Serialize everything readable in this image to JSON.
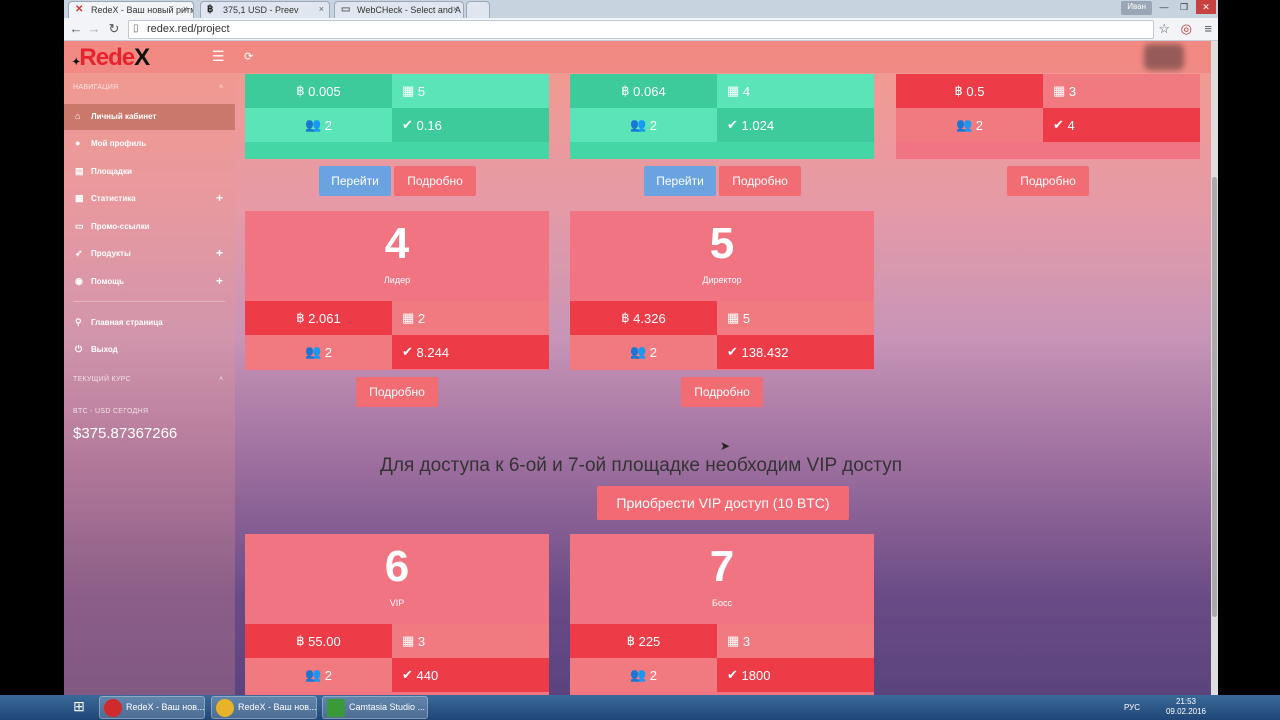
{
  "tabs": [
    {
      "label": "RedeX - Ваш новый ритм",
      "icon": "x-icon"
    },
    {
      "label": "375,1 USD - Preev",
      "icon": "bitcoin-icon"
    },
    {
      "label": "WebCHeck - Select and A",
      "icon": "page-icon"
    }
  ],
  "window": {
    "user": "Иван",
    "minimize": "—",
    "maximize": "❐",
    "close": "✕"
  },
  "address": {
    "url": "redex.red/project"
  },
  "logo": {
    "text": "Rede",
    "x": "X"
  },
  "sidebar": {
    "nav_heading": "НАВИГАЦИЯ",
    "items": [
      {
        "label": "Личный кабинет",
        "icon": "home-icon"
      },
      {
        "label": "Мой профиль",
        "icon": "user-icon"
      },
      {
        "label": "Площадки",
        "icon": "grid-icon"
      },
      {
        "label": "Статистика",
        "icon": "chart-icon"
      },
      {
        "label": "Промо-ссылки",
        "icon": "link-icon"
      },
      {
        "label": "Продукты",
        "icon": "rocket-icon"
      },
      {
        "label": "Помощь",
        "icon": "help-icon"
      },
      {
        "label": "Главная страница",
        "icon": "link-icon"
      },
      {
        "label": "Выход",
        "icon": "power-icon"
      }
    ],
    "rate_heading": "ТЕКУЩИЙ КУРС",
    "rate_label": "BTC - USD СЕГОДНЯ",
    "rate_value": "$375.87367266"
  },
  "top_cards": [
    {
      "btc": "0.005",
      "places": "5",
      "people": "2",
      "earn": "0.16",
      "go": "Перейти",
      "more": "Подробно",
      "color": "green"
    },
    {
      "btc": "0.064",
      "places": "4",
      "people": "2",
      "earn": "1.024",
      "go": "Перейти",
      "more": "Подробно",
      "color": "green"
    },
    {
      "btc": "0.5",
      "places": "3",
      "people": "2",
      "earn": "4",
      "more": "Подробно",
      "color": "red"
    }
  ],
  "mid_cards": [
    {
      "num": "4",
      "title": "Лидер",
      "btc": "2.061",
      "places": "2",
      "people": "2",
      "earn": "8.244",
      "more": "Подробно"
    },
    {
      "num": "5",
      "title": "Директор",
      "btc": "4.326",
      "places": "5",
      "people": "2",
      "earn": "138.432",
      "more": "Подробно"
    }
  ],
  "vip": {
    "text": "Для доступа к 6-ой и 7-ой площадке необходим VIP доступ",
    "button": "Приобрести VIP доступ (10 BTC)"
  },
  "vip_cards": [
    {
      "num": "6",
      "title": "VIP",
      "btc": "55.00",
      "places": "3",
      "people": "2",
      "earn": "440"
    },
    {
      "num": "7",
      "title": "Босс",
      "btc": "225",
      "places": "3",
      "people": "2",
      "earn": "1800"
    }
  ],
  "taskbar": {
    "items": [
      {
        "label": "RedeX - Ваш нов...",
        "color": "#d12a2a"
      },
      {
        "label": "RedeX - Ваш нов...",
        "color": "#e8b32a"
      },
      {
        "label": "Camtasia Studio ...",
        "color": "#3a9a3a"
      }
    ],
    "lang": "РУС",
    "time": "21:53",
    "date": "09.02.2016"
  },
  "colors": {
    "card_red": "#f17483",
    "card_dark_red": "#ee3b48",
    "card_green": "#45d6a5",
    "btn_blue": "#6ba3e0",
    "btn_red": "#f26c73"
  }
}
